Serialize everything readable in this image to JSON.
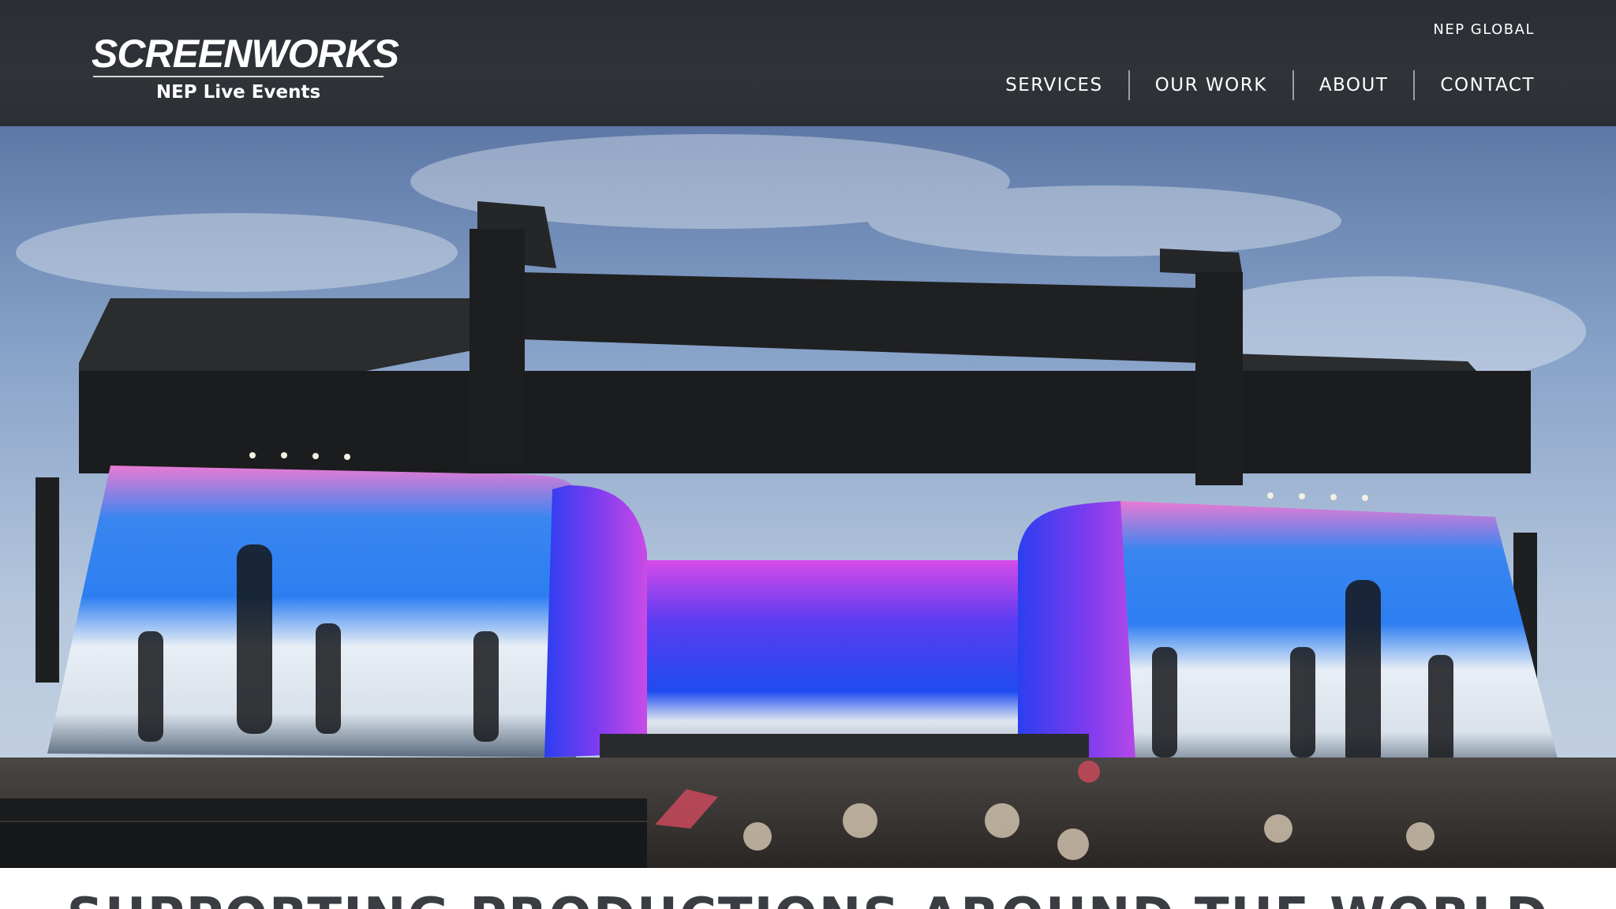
{
  "header": {
    "logo": {
      "wordmark": "SCREENWORKS",
      "subline": "NEP Live Events"
    },
    "utility_link": "NEP GLOBAL",
    "nav": [
      "SERVICES",
      "OUR WORK",
      "ABOUT",
      "CONTACT"
    ]
  },
  "hero": {
    "image": "outdoor festival main stage with large LED video walls and crowd"
  },
  "section": {
    "heading": "SUPPORTING PRODUCTIONS AROUND THE WORLD"
  },
  "colors": {
    "header_bg": "#2e3237",
    "nav_text": "#ffffff",
    "heading_text": "#3a3d42",
    "screen_pink": "#f06bd2",
    "screen_blue": "#1d4df0"
  }
}
